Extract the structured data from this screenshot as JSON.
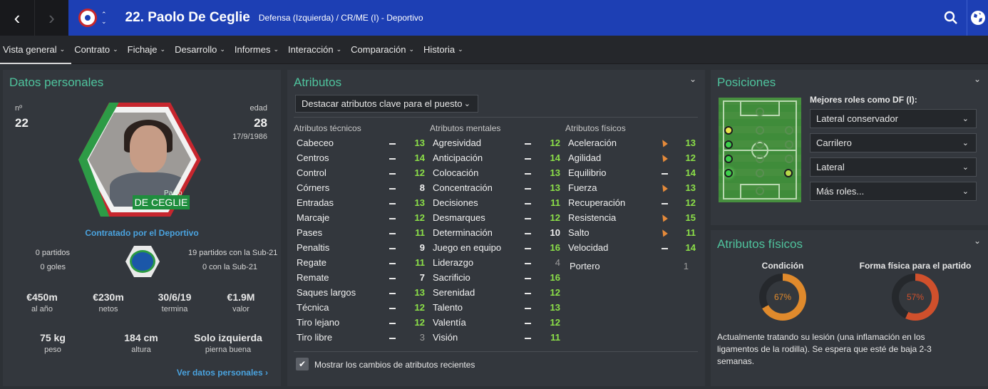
{
  "header": {
    "title": "22. Paolo De Ceglie",
    "subtitle": "Defensa (Izquierda) / CR/ME (I) - Deportivo",
    "back_icon": "‹",
    "forward_icon": "›"
  },
  "tabs": [
    {
      "label": "Vista general"
    },
    {
      "label": "Contrato"
    },
    {
      "label": "Fichaje"
    },
    {
      "label": "Desarrollo"
    },
    {
      "label": "Informes"
    },
    {
      "label": "Interacción"
    },
    {
      "label": "Comparación"
    },
    {
      "label": "Historia"
    }
  ],
  "personal": {
    "title": "Datos personales",
    "number_label": "nº",
    "number": "22",
    "age_label": "edad",
    "age": "28",
    "birthdate": "17/9/1986",
    "photo_first_name": "Paolo",
    "photo_last_name": "DE CEGLIE",
    "signed_text": "Contratado por el Deportivo",
    "intl_caps_left": "0 partidos",
    "intl_goals_left": "0 goles",
    "intl_caps_right": "19 partidos con la Sub-21",
    "intl_goals_right": "0 con la Sub-21",
    "stats": [
      {
        "value": "€450m",
        "label": "al año"
      },
      {
        "value": "€230m",
        "label": "netos"
      },
      {
        "value": "30/6/19",
        "label": "termina"
      },
      {
        "value": "€1.9M",
        "label": "valor"
      }
    ],
    "physical": [
      {
        "value": "75 kg",
        "label": "peso"
      },
      {
        "value": "184 cm",
        "label": "altura"
      },
      {
        "value": "Solo izquierda",
        "label": "pierna buena"
      }
    ],
    "link": "Ver datos personales"
  },
  "attributes": {
    "title": "Atributos",
    "highlight_select": "Destacar atributos clave para el puesto",
    "technical_header": "Atributos técnicos",
    "mental_header": "Atributos mentales",
    "physical_header": "Atributos físicos",
    "technical": [
      {
        "name": "Cabeceo",
        "value": "13",
        "color": "green"
      },
      {
        "name": "Centros",
        "value": "14",
        "color": "green"
      },
      {
        "name": "Control",
        "value": "12",
        "color": "green"
      },
      {
        "name": "Córners",
        "value": "8",
        "color": "white"
      },
      {
        "name": "Entradas",
        "value": "13",
        "color": "green"
      },
      {
        "name": "Marcaje",
        "value": "12",
        "color": "green"
      },
      {
        "name": "Pases",
        "value": "11",
        "color": "green"
      },
      {
        "name": "Penaltis",
        "value": "9",
        "color": "white"
      },
      {
        "name": "Regate",
        "value": "11",
        "color": "green"
      },
      {
        "name": "Remate",
        "value": "7",
        "color": "white"
      },
      {
        "name": "Saques largos",
        "value": "13",
        "color": "green"
      },
      {
        "name": "Técnica",
        "value": "12",
        "color": "green"
      },
      {
        "name": "Tiro lejano",
        "value": "12",
        "color": "green"
      },
      {
        "name": "Tiro libre",
        "value": "3",
        "color": "gray"
      }
    ],
    "mental": [
      {
        "name": "Agresividad",
        "value": "12",
        "color": "green"
      },
      {
        "name": "Anticipación",
        "value": "14",
        "color": "green"
      },
      {
        "name": "Colocación",
        "value": "13",
        "color": "green"
      },
      {
        "name": "Concentración",
        "value": "13",
        "color": "green"
      },
      {
        "name": "Decisiones",
        "value": "11",
        "color": "green"
      },
      {
        "name": "Desmarques",
        "value": "12",
        "color": "green"
      },
      {
        "name": "Determinación",
        "value": "10",
        "color": "white"
      },
      {
        "name": "Juego en equipo",
        "value": "16",
        "color": "green"
      },
      {
        "name": "Liderazgo",
        "value": "4",
        "color": "gray"
      },
      {
        "name": "Sacrificio",
        "value": "16",
        "color": "green"
      },
      {
        "name": "Serenidad",
        "value": "12",
        "color": "green"
      },
      {
        "name": "Talento",
        "value": "13",
        "color": "green"
      },
      {
        "name": "Valentía",
        "value": "12",
        "color": "green"
      },
      {
        "name": "Visión",
        "value": "11",
        "color": "green"
      }
    ],
    "physical": [
      {
        "name": "Aceleración",
        "value": "13",
        "color": "green",
        "trend": "down"
      },
      {
        "name": "Agilidad",
        "value": "12",
        "color": "green",
        "trend": "down"
      },
      {
        "name": "Equilibrio",
        "value": "14",
        "color": "green",
        "trend": "same"
      },
      {
        "name": "Fuerza",
        "value": "13",
        "color": "green",
        "trend": "down"
      },
      {
        "name": "Recuperación",
        "value": "12",
        "color": "green",
        "trend": "same"
      },
      {
        "name": "Resistencia",
        "value": "15",
        "color": "green",
        "trend": "down"
      },
      {
        "name": "Salto",
        "value": "11",
        "color": "green",
        "trend": "down"
      },
      {
        "name": "Velocidad",
        "value": "14",
        "color": "green",
        "trend": "same"
      }
    ],
    "goalkeeper": {
      "name": "Portero",
      "value": "1"
    },
    "checkbox_label": "Mostrar los cambios de atributos recientes"
  },
  "positions": {
    "title": "Posiciones",
    "roles_heading": "Mejores roles como DF (I):",
    "roles": [
      "Lateral conservador",
      "Carrilero",
      "Lateral",
      "Más roles..."
    ]
  },
  "fitness": {
    "title": "Atributos físicos",
    "condition_label": "Condición",
    "condition_value": "67%",
    "condition_fraction": 0.67,
    "match_label": "Forma física para el partido",
    "match_value": "57%",
    "match_fraction": 0.57,
    "injury_text": "Actualmente tratando su lesión (una inflamación en los ligamentos de la rodilla). Se espera que esté de baja 2-3 semanas."
  },
  "colors": {
    "header_blue": "#1d3fb4",
    "accent_green": "#4fc39d",
    "value_green": "#8ce048",
    "link_blue": "#4aa3df",
    "condition_orange": "#e08a2c",
    "match_orange": "#d0502c"
  }
}
